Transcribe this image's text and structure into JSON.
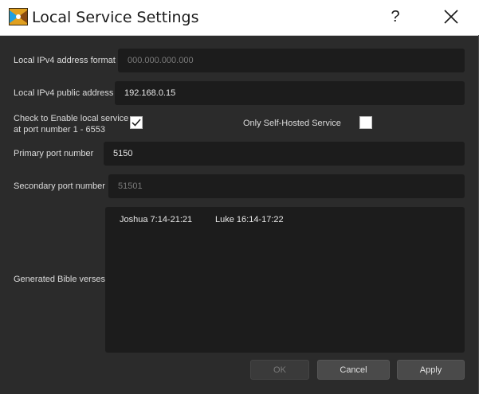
{
  "window": {
    "title": "Local Service Settings",
    "help_label": "?",
    "icons": {
      "app": "app-icon",
      "close": "close-icon"
    }
  },
  "form": {
    "ipv4_format": {
      "label": "Local IPv4 address format",
      "placeholder": "000.000.000.000",
      "value": ""
    },
    "ipv4_public": {
      "label": "Local IPv4 public address",
      "value": "192.168.0.15"
    },
    "enable_local": {
      "label_line1": "Check to Enable local service",
      "label_line2": "at port number 1 - 6553",
      "checked": true
    },
    "self_hosted": {
      "label": "Only Self-Hosted Service",
      "checked": false
    },
    "primary_port": {
      "label": "Primary  port  number",
      "value": "5150"
    },
    "secondary_port": {
      "label": "Secondary port number",
      "placeholder": "51501",
      "value": ""
    },
    "bible_verses": {
      "label": "Generated Bible verses",
      "items": [
        "Joshua 7:14-21:21",
        "Luke 16:14-17:22"
      ]
    }
  },
  "buttons": {
    "ok": "OK",
    "cancel": "Cancel",
    "apply": "Apply"
  }
}
